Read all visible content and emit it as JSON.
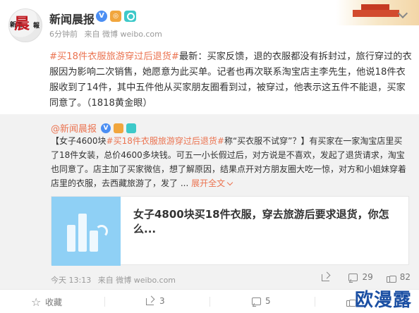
{
  "account": {
    "name": "新闻晨报",
    "logo_text_main": "晨",
    "logo_text_left": "新闻",
    "logo_text_right": "報",
    "badge_v": "V",
    "badge_2": "◎"
  },
  "post": {
    "time": "6分钟前",
    "source": "来自 微博 weibo.com",
    "topic": "#买18件衣服旅游穿过后退货#",
    "text": "最新：买家反馈，退的衣服都没有拆封过，旅行穿过的衣服因为影响二次销售，她愿意为此买单。记者也再次联系淘宝店主李先生，他说18件衣服收到了14件，其中五件他从买家朋友圈看到过，被穿过，他表示这五件不能退，买家同意了。（1818黄金眼）"
  },
  "quoted": {
    "at_name": "@新闻晨报",
    "badge_v": "V",
    "bracket_open": "【女子4600块",
    "topic": "#买18件衣服旅游穿过后退货#",
    "text": "称“买衣服不试穿”？】有买家在一家淘宝店里买了18件女装，总价4600多块钱。可五一小长假过后，对方说是不喜欢，发起了退货请求，淘宝也同意了。店主加了买家微信，想了解原因，结果点开对方朋友圈大吃一惊，对方和小姐妹穿着店里的衣服，去西藏旅游了，发了 ...",
    "expand": "展开全文",
    "card_title": "女子4800块买18件衣服，穿去旅游后要求退货，你怎么...",
    "time": "今天 13:13",
    "source": "来自 微博 weibo.com",
    "share_count": "",
    "comment_count": "29",
    "like_count": "82"
  },
  "actions": {
    "favorite": "收藏",
    "share": "3",
    "comment": "5",
    "like": ""
  },
  "watermark": "欧漫露",
  "colors": {
    "topic": "#eb7350",
    "verified": "#4b8ef3",
    "watermark": "#1b4fa3"
  }
}
